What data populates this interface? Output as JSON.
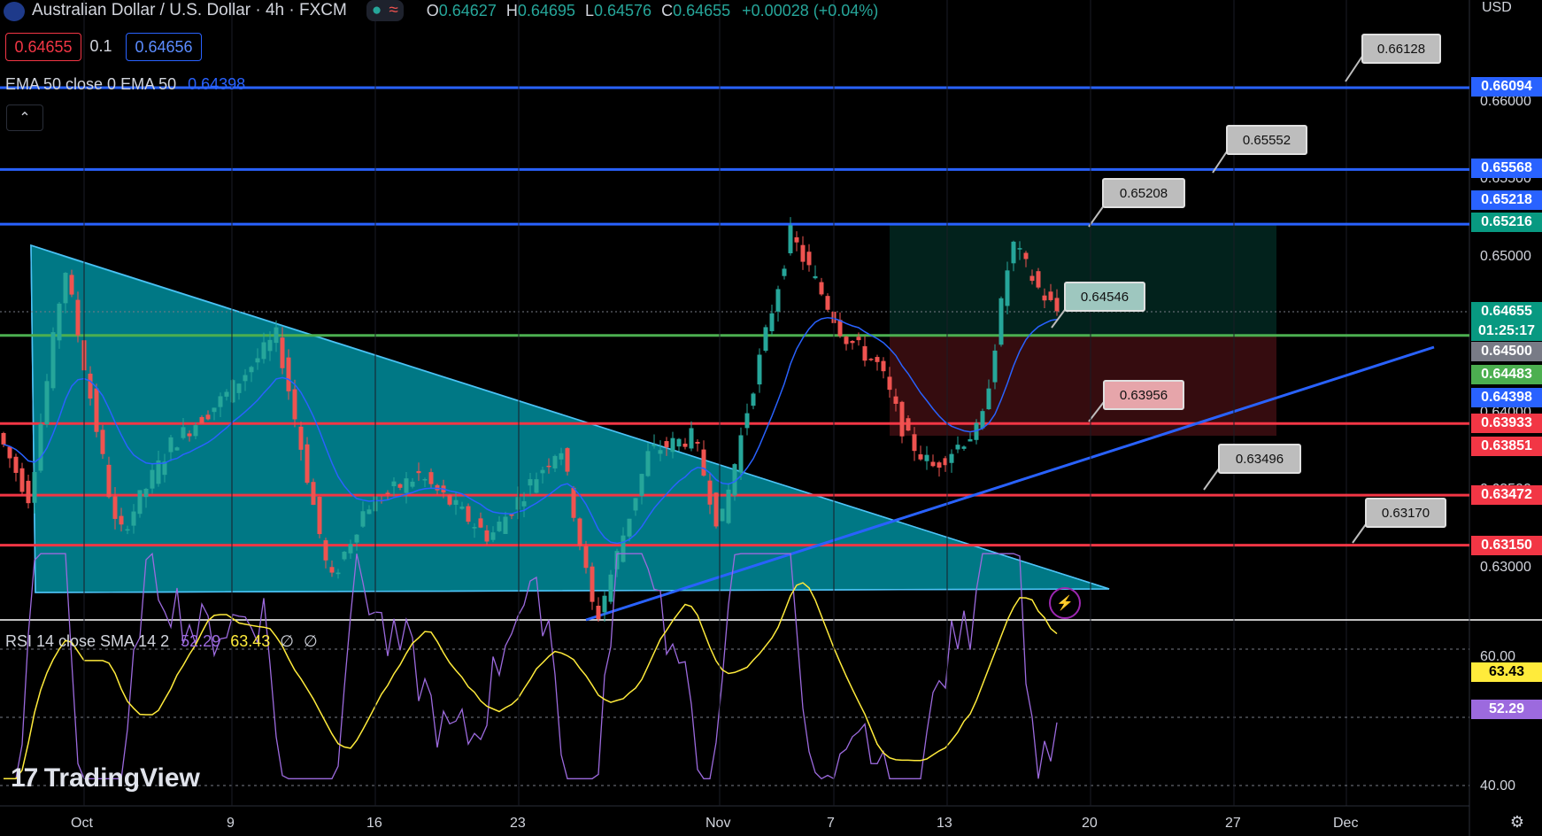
{
  "header": {
    "symbol_title": "Australian Dollar / U.S. Dollar · 4h · FXCM",
    "ohlc": {
      "o_label": "O",
      "o": "0.64627",
      "h_label": "H",
      "h": "0.64695",
      "l_label": "L",
      "l": "0.64576",
      "c_label": "C",
      "c": "0.64655",
      "change": "+0.00028 (+0.04%)"
    },
    "sell_price": "0.64655",
    "spread": "0.1",
    "buy_price": "0.64656",
    "currency": "USD"
  },
  "ema_indicator": {
    "label": "EMA 50 close 0 EMA 50",
    "value": "0.64398"
  },
  "rsi_indicator": {
    "label": "RSI 14 close SMA 14 2",
    "rsi": "52.29",
    "sma": "63.43",
    "extra1": "∅",
    "extra2": "∅"
  },
  "price_axis": {
    "labels": [
      "0.66000",
      "0.65500",
      "0.65000",
      "0.64500",
      "0.64000",
      "0.63500",
      "0.63000"
    ],
    "tags": [
      {
        "value": "0.66094",
        "color": "#2962ff"
      },
      {
        "value": "0.65568",
        "color": "#2962ff"
      },
      {
        "value": "0.65218",
        "color": "#2962ff"
      },
      {
        "value": "0.65216",
        "color": "#089981"
      },
      {
        "value": "0.64655",
        "color": "#089981"
      },
      {
        "value": "01:25:17",
        "color": "#089981"
      },
      {
        "value": "0.64500",
        "color": "#787b86"
      },
      {
        "value": "0.64483",
        "color": "#4caf50"
      },
      {
        "value": "0.64398",
        "color": "#2962ff"
      },
      {
        "value": "0.63933",
        "color": "#f23645"
      },
      {
        "value": "0.63851",
        "color": "#f23645"
      },
      {
        "value": "0.63472",
        "color": "#f23645"
      },
      {
        "value": "0.63150",
        "color": "#f23645"
      }
    ],
    "rsi_labels": [
      "60.00",
      "40.00"
    ],
    "rsi_tags": [
      {
        "value": "63.43",
        "color": "#ffeb3b"
      },
      {
        "value": "52.29",
        "color": "#9c6ade"
      }
    ]
  },
  "callouts": [
    "0.66128",
    "0.65552",
    "0.65208",
    "0.64546",
    "0.63956",
    "0.63496",
    "0.63170"
  ],
  "time_axis": [
    "Oct",
    "9",
    "16",
    "23",
    "Nov",
    "7",
    "13",
    "20",
    "27",
    "Dec"
  ],
  "watermark": "TradingView",
  "colors": {
    "up": "#26a69a",
    "down": "#ef5350",
    "resistance": "#2962ff",
    "support": "#f23645",
    "ema": "#2962ff",
    "rsi": "#9c6ade",
    "rsi_sma": "#ffeb3b"
  }
}
